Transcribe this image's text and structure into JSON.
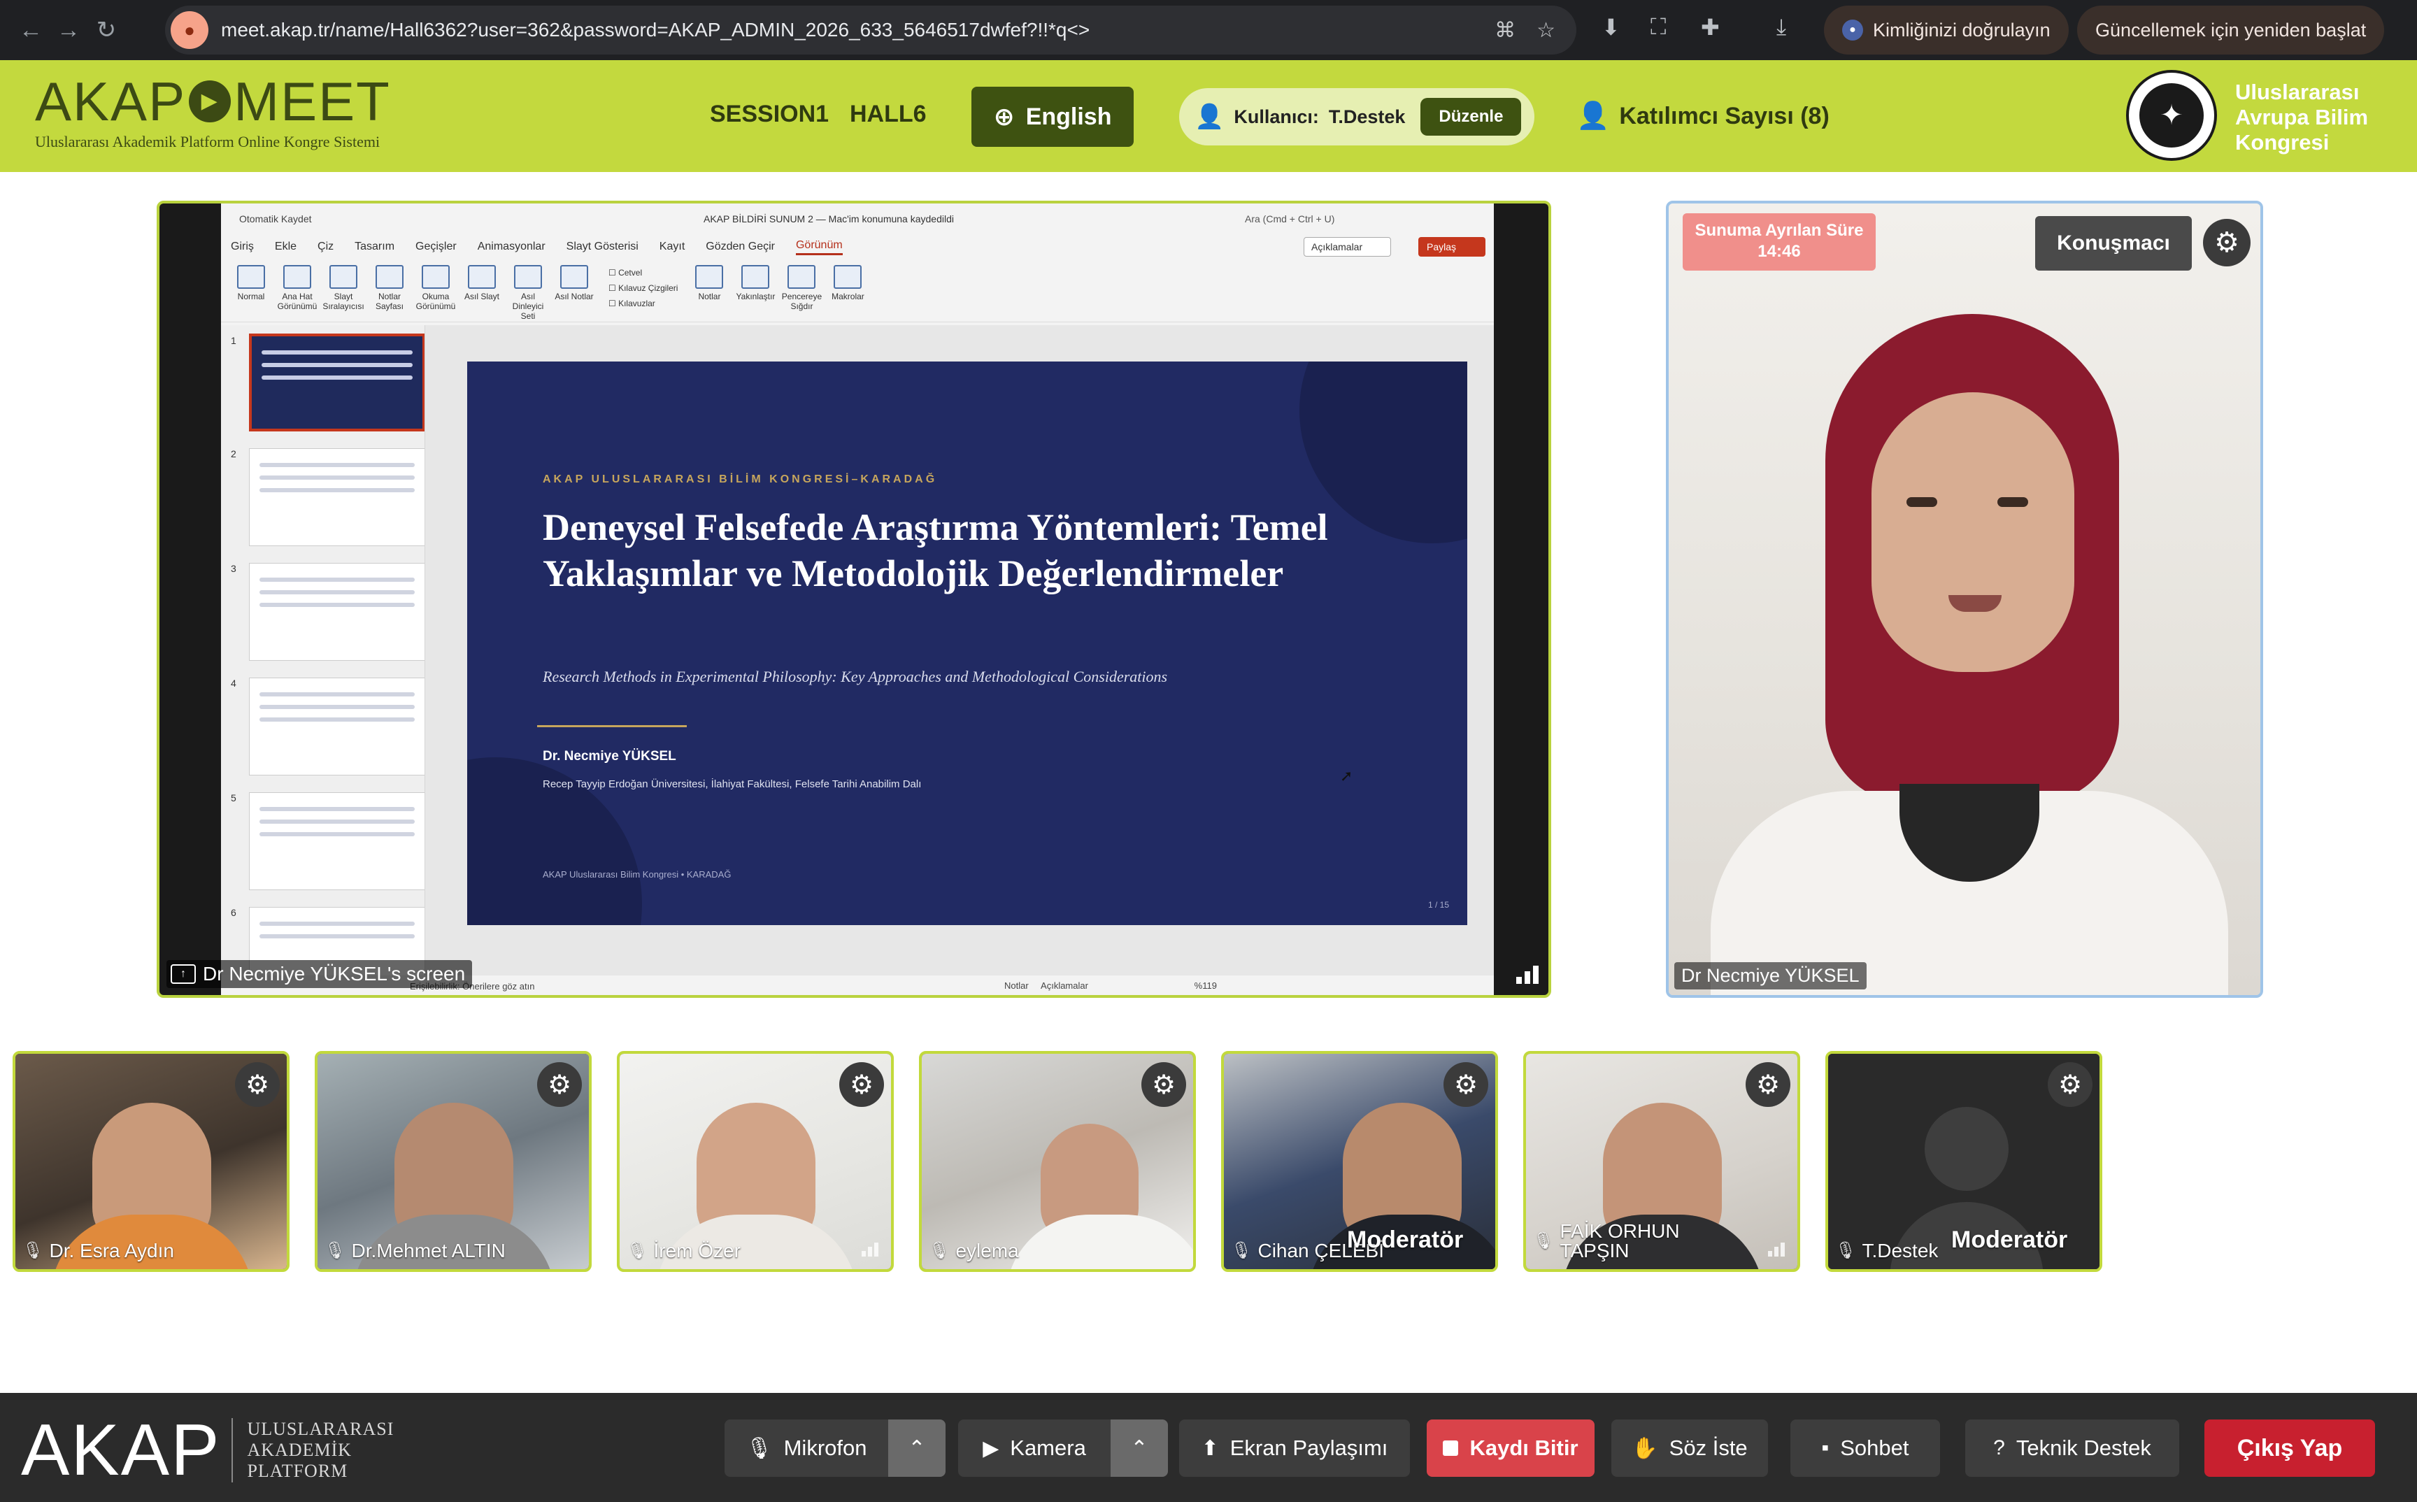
{
  "browser": {
    "url": "meet.akap.tr/name/Hall6362?user=362&password=AKAP_ADMIN_2026_633_5646517dwfef?!!*q<>",
    "verify_chip": "Kimliğinizi doğrulayın",
    "update_chip": "Güncellemek için yeniden başlat"
  },
  "header": {
    "logo_left": "AKAP",
    "logo_right": "MEET",
    "logo_subtitle": "Uluslararası Akademik Platform Online Kongre Sistemi",
    "session": "SESSION1",
    "hall": "HALL6",
    "language": "English",
    "user_label": "Kullanıcı:",
    "user_name": "T.Destek",
    "edit_label": "Düzenle",
    "participants": "Katılımcı Sayısı (8)",
    "congress_line1": "Uluslararası",
    "congress_line2": "Avrupa Bilim",
    "congress_line3": "Kongresi"
  },
  "screen_share": {
    "label": "Dr Necmiye YÜKSEL's screen",
    "ppt": {
      "autosave": "Otomatik Kaydet",
      "doc_title": "AKAP BİLDİRİ SUNUM 2 — Mac'im konumuna kaydedildi",
      "search": "Ara (Cmd + Ctrl + U)",
      "menu": [
        "Giriş",
        "Ekle",
        "Çiz",
        "Tasarım",
        "Geçişler",
        "Animasyonlar",
        "Slayt Gösterisi",
        "Kayıt",
        "Gözden Geçir",
        "Görünüm"
      ],
      "comments": "Açıklamalar",
      "share": "Paylaş",
      "ribbon": [
        "Normal",
        "Ana Hat Görünümü",
        "Slayt Sıralayıcısı",
        "Notlar Sayfası",
        "Okuma Görünümü",
        "Asıl Slayt",
        "Asıl Dinleyici Seti",
        "Asıl Notlar"
      ],
      "checks": [
        "Cetvel",
        "Kılavuz Çizgileri",
        "Kılavuzlar"
      ],
      "ribbon2": [
        "Notlar",
        "Yakınlaştır",
        "Pencereye Sığdır",
        "Makrolar"
      ],
      "thumb_numbers": [
        "1",
        "2",
        "3",
        "4",
        "5",
        "6"
      ],
      "status_left": "Erişilebilirlik: Önerilere göz atın",
      "status_notes": "Notlar",
      "status_comments": "Açıklamalar",
      "zoom": "%119"
    },
    "slide": {
      "kicker": "AKAP ULUSLARARASI BİLİM KONGRESİ–KARADAĞ",
      "title": "Deneysel Felsefede Araştırma Yöntemleri: Temel Yaklaşımlar ve Metodolojik Değerlendirmeler",
      "subtitle": "Research Methods in Experimental Philosophy: Key Approaches and Methodological Considerations",
      "author": "Dr. Necmiye YÜKSEL",
      "affiliation": "Recep Tayyip Erdoğan Üniversitesi, İlahiyat Fakültesi, Felsefe Tarihi Anabilim Dalı",
      "footer": "AKAP Uluslararası Bilim Kongresi  •  KARADAĞ",
      "page": "1 / 15"
    }
  },
  "speaker": {
    "timer_label": "Sunuma Ayrılan Süre",
    "timer_value": "14:46",
    "role_button": "Konuşmacı",
    "name": "Dr Necmiye YÜKSEL"
  },
  "participants": [
    {
      "name": "Dr. Esra Aydın",
      "moderator": ""
    },
    {
      "name": "Dr.Mehmet ALTIN",
      "moderator": ""
    },
    {
      "name": "İrem Özer",
      "moderator": ""
    },
    {
      "name": "eylema",
      "moderator": ""
    },
    {
      "name": "Cihan ÇELEBİ",
      "moderator": "Moderatör"
    },
    {
      "name": "FAİK ORHUN TAPŞIN",
      "moderator": ""
    },
    {
      "name": "T.Destek",
      "moderator": "Moderatör"
    }
  ],
  "toolbar": {
    "brand": "AKAP",
    "brand_sub1": "ULUSLARARASI",
    "brand_sub2": "AKADEMİK",
    "brand_sub3": "PLATFORM",
    "mic": "Mikrofon",
    "camera": "Kamera",
    "share": "Ekran Paylaşımı",
    "record": "Kaydı Bitir",
    "hand": "Söz İste",
    "chat": "Sohbet",
    "support": "Teknik Destek",
    "exit": "Çıkış Yap"
  },
  "colors": {
    "header_green": "#c3d93e",
    "dark_green": "#3e5211",
    "slide_navy": "#212a63",
    "record_red": "#d9434a",
    "exit_red": "#c8202f",
    "timer_pink": "#f08f8b"
  }
}
